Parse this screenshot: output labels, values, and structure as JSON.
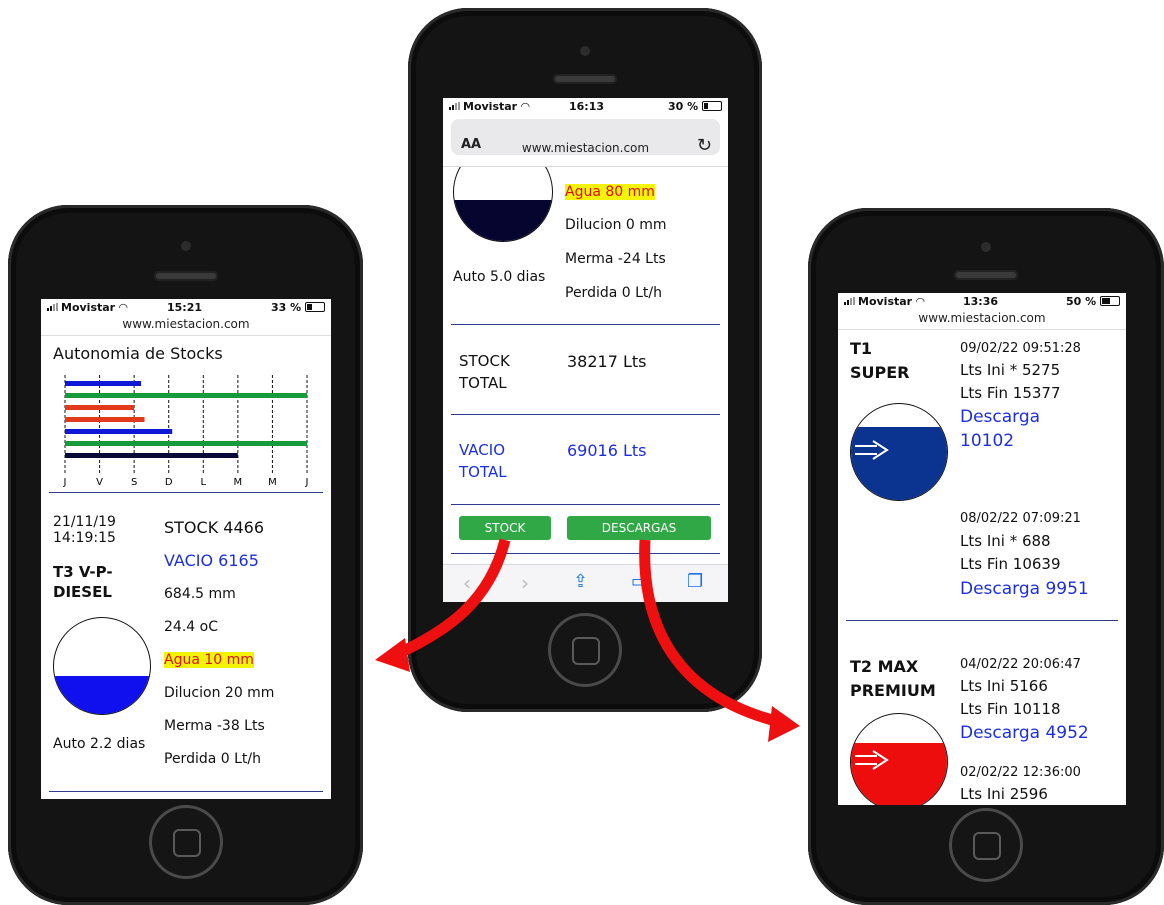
{
  "phone_left": {
    "status": {
      "carrier": "Movistar",
      "time": "15:21",
      "battery": "33 %"
    },
    "url": "www.miestacion.com",
    "title": "Autonomia de Stocks",
    "chart_data": {
      "type": "bar",
      "axis_labels": [
        "J",
        "V",
        "S",
        "D",
        "L",
        "M",
        "M",
        "J"
      ],
      "bars": [
        {
          "color": "#1018d8",
          "value": 2.2
        },
        {
          "color": "#169a3c",
          "value": 7.0
        },
        {
          "color": "#e23b1c",
          "value": 2.0
        },
        {
          "color": "#e23b1c",
          "value": 2.3
        },
        {
          "color": "#1018d8",
          "value": 3.1
        },
        {
          "color": "#169a3c",
          "value": 7.0
        },
        {
          "color": "#0a0a3a",
          "value": 5.0
        }
      ],
      "xlim": [
        0,
        7
      ]
    },
    "date": "21/11/19",
    "time": "14:19:15",
    "tank_name": "T3 V-P-DIESEL",
    "tank_name_l1": "T3 V-P-",
    "tank_name_l2": "DIESEL",
    "stock": "STOCK 4466",
    "vacio": "VACIO 6165",
    "level": "684.5 mm",
    "temp": "24.4 oC",
    "agua": "Agua 10 mm",
    "dilucion": "Dilucion 20 mm",
    "merma": "Merma -38 Lts",
    "perdida": "Perdida 0 Lt/h",
    "auto": "Auto 2.2 dias",
    "tank_fill_fraction": 0.4,
    "tank_color": "#1010ee"
  },
  "phone_middle": {
    "status": {
      "carrier": "Movistar",
      "time": "16:13",
      "battery": "30 %"
    },
    "url": "www.miestacion.com",
    "aa": "AA",
    "agua": "Agua 80 mm",
    "dilucion": "Dilucion 0 mm",
    "merma": "Merma -24 Lts",
    "perdida": "Perdida 0 Lt/h",
    "auto": "Auto 5.0 dias",
    "stock_total_l1": "STOCK",
    "stock_total_l2": "TOTAL",
    "stock_total_value": "38217 Lts",
    "vacio_total_l1": "VACIO",
    "vacio_total_l2": "TOTAL",
    "vacio_total_value": "69016 Lts",
    "btn_stock": "STOCK",
    "btn_descargas": "DESCARGAS",
    "tank_color": "#050530"
  },
  "phone_right": {
    "status": {
      "carrier": "Movistar",
      "time": "13:36",
      "battery": "50 %"
    },
    "url": "www.miestacion.com",
    "t1_l1": "T1",
    "t1_l2": "SUPER",
    "t1_color": "#0a3490",
    "d1_date": "09/02/22 09:51:28",
    "d1_ini": "Lts Ini * 5275",
    "d1_fin": "Lts Fin 15377",
    "d1_desc_l1": "Descarga",
    "d1_desc_l2": "10102",
    "d2_date": "08/02/22 07:09:21",
    "d2_ini": "Lts Ini * 688",
    "d2_fin": "Lts Fin 10639",
    "d2_desc": "Descarga 9951",
    "t2_l1": "T2 MAX",
    "t2_l2": "PREMIUM",
    "t2_color": "#ee0d0d",
    "d3_date": "04/02/22 20:06:47",
    "d3_ini": "Lts Ini 5166",
    "d3_fin": "Lts Fin 10118",
    "d3_desc": "Descarga 4952",
    "d4_date": "02/02/22 12:36:00",
    "d4_ini": "Lts Ini 2596"
  }
}
